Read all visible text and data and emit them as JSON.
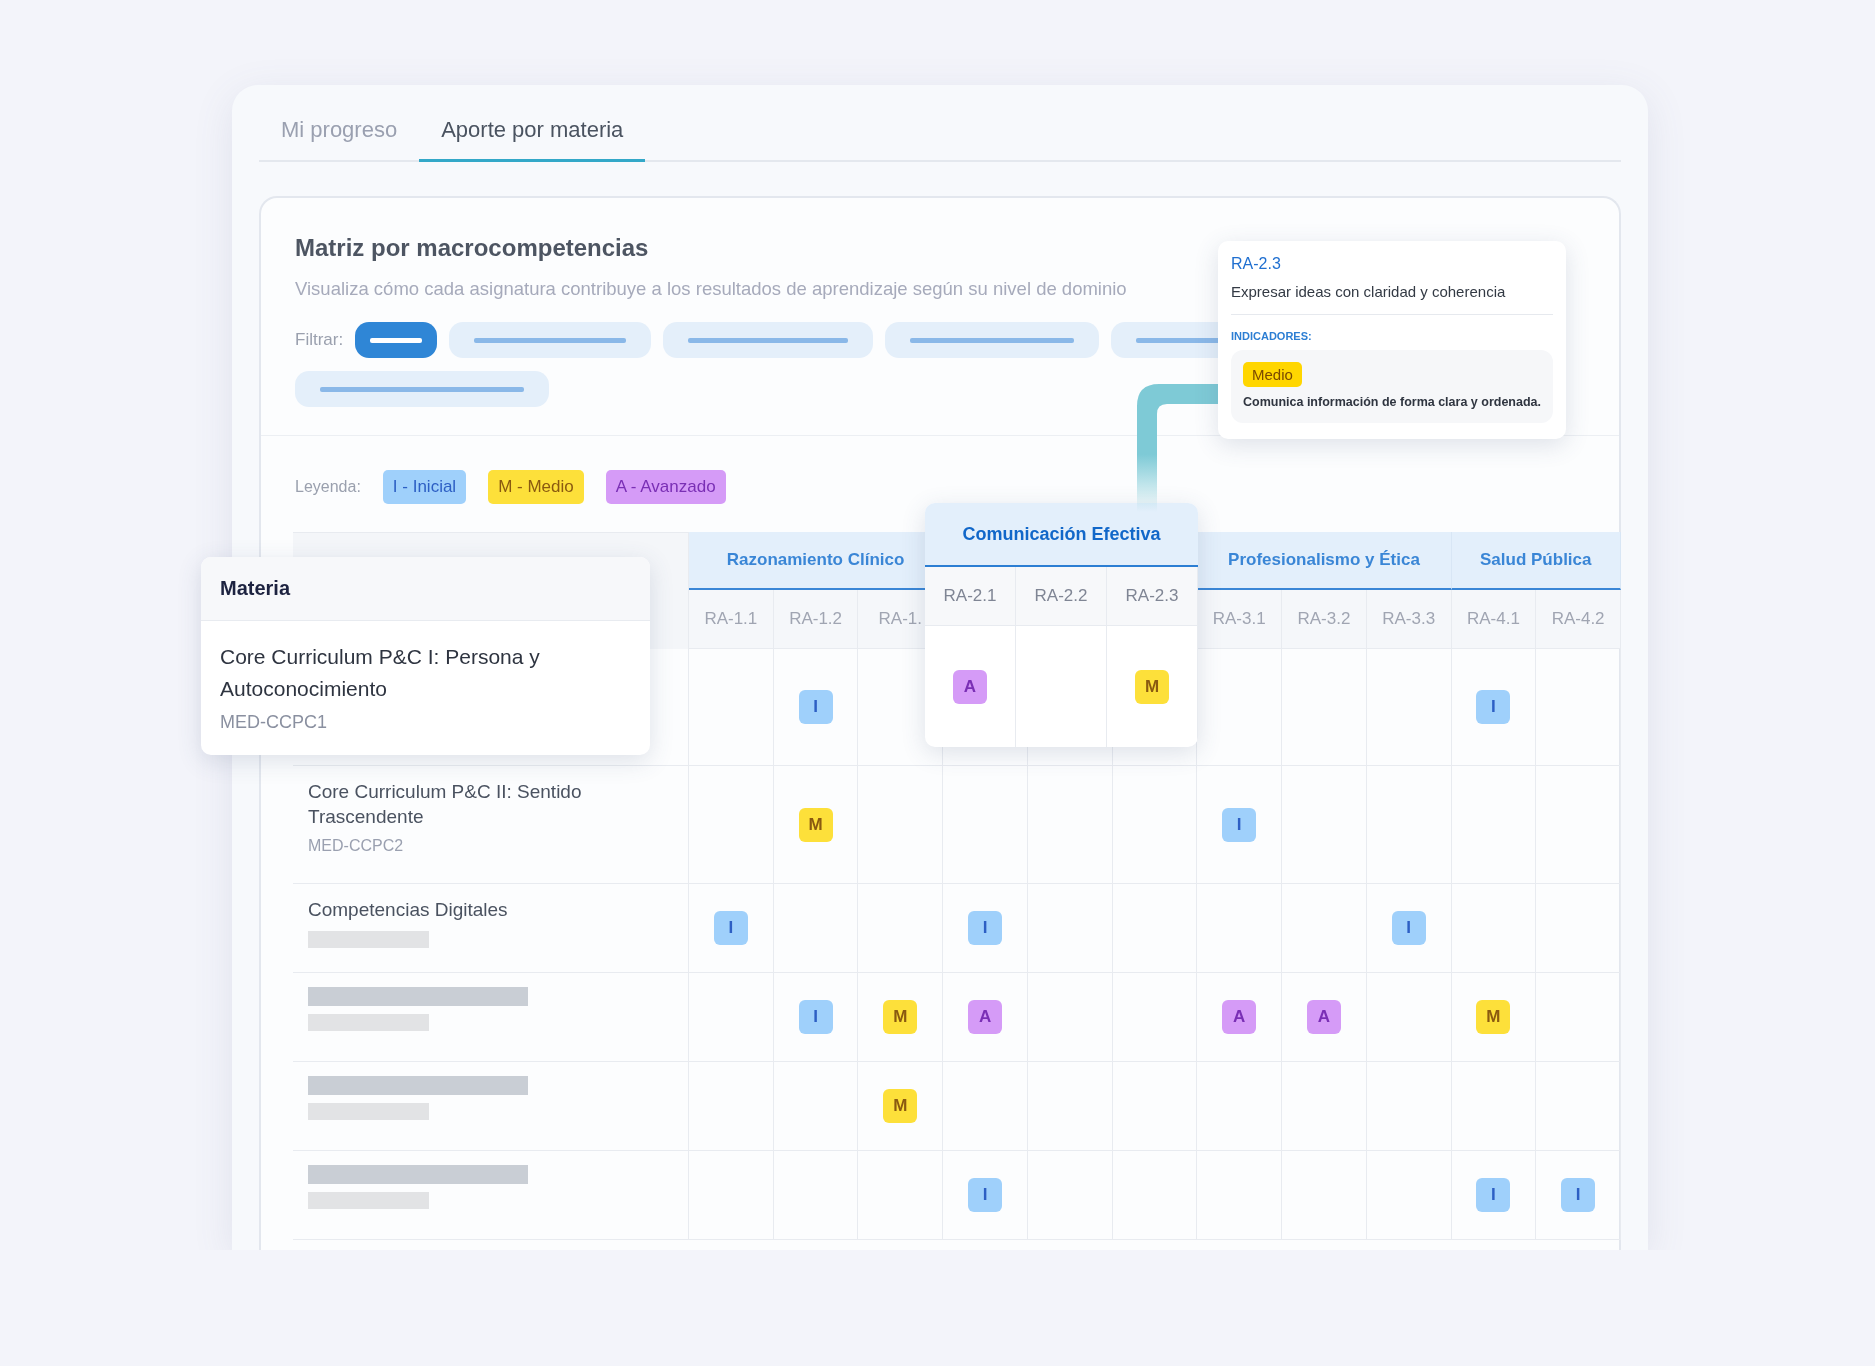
{
  "tabs": [
    {
      "label": "Mi progreso",
      "selected": false
    },
    {
      "label": "Aporte por materia",
      "selected": true
    }
  ],
  "panel": {
    "title": "Matriz por macrocompetencias",
    "subtitle": "Visualiza cómo cada asignatura contribuye a los resultados de aprendizaje según su nivel de dominio"
  },
  "filters": {
    "label": "Filtrar:",
    "chips": [
      {
        "selected": true
      },
      {
        "selected": false
      },
      {
        "selected": false
      },
      {
        "selected": false
      },
      {
        "selected": false
      },
      {
        "selected": false
      }
    ]
  },
  "legend": {
    "label": "Leyenda:",
    "items": [
      {
        "text": "I - Inicial",
        "kind": "inicial"
      },
      {
        "text": "M - Medio",
        "kind": "medio"
      },
      {
        "text": "A - Avanzado",
        "kind": "avanzado"
      }
    ]
  },
  "tooltip": {
    "code": "RA-2.3",
    "description": "Expresar ideas con claridad y coherencia",
    "section": "INDICADORES:",
    "badge": {
      "text": "Medio",
      "kind": "medio"
    },
    "indicator": "Comunica información de forma clara y ordenada."
  },
  "table": {
    "column_header": "Materia",
    "groups": [
      {
        "title": "Razonamiento Clínico",
        "raised": false,
        "columns": [
          "RA-1.1",
          "RA-1.2",
          "RA-1."
        ]
      },
      {
        "title": "Comunicación Efectiva",
        "raised": true,
        "columns": [
          "RA-2.1",
          "RA-2.2",
          "RA-2.3"
        ]
      },
      {
        "title": "Profesionalismo y Ética",
        "raised": false,
        "columns": [
          "RA-3.1",
          "RA-3.2",
          "RA-3.3"
        ]
      },
      {
        "title": "Salud Pública",
        "raised": false,
        "columns": [
          "RA-4.1",
          "RA-4.2"
        ]
      }
    ],
    "rows": [
      {
        "raised": true,
        "name": "Core Curriculum P&C I: Persona y Autoconocimiento",
        "code": "MED-CCPC1",
        "cells": [
          null,
          {
            "text": "I",
            "kind": "inicial"
          },
          null,
          {
            "text": "A",
            "kind": "avanzado"
          },
          null,
          {
            "text": "M",
            "kind": "medio"
          },
          null,
          null,
          null,
          {
            "text": "I",
            "kind": "inicial"
          },
          null
        ]
      },
      {
        "raised": false,
        "name": "Core Curriculum P&C II: Sentido Trascendente",
        "code": "MED-CCPC2",
        "cells": [
          null,
          {
            "text": "M",
            "kind": "medio"
          },
          null,
          null,
          null,
          null,
          {
            "text": "I",
            "kind": "inicial"
          },
          null,
          null,
          null,
          null
        ]
      },
      {
        "raised": false,
        "name": "Competencias Digitales",
        "cells": [
          {
            "text": "I",
            "kind": "inicial"
          },
          null,
          null,
          {
            "text": "I",
            "kind": "inicial"
          },
          null,
          null,
          null,
          null,
          {
            "text": "I",
            "kind": "inicial"
          },
          null,
          null
        ]
      },
      {
        "raised": false,
        "cells": [
          null,
          {
            "text": "I",
            "kind": "inicial"
          },
          {
            "text": "M",
            "kind": "medio"
          },
          {
            "text": "A",
            "kind": "avanzado"
          },
          null,
          null,
          {
            "text": "A",
            "kind": "avanzado"
          },
          {
            "text": "A",
            "kind": "avanzado"
          },
          null,
          {
            "text": "M",
            "kind": "medio"
          },
          null
        ]
      },
      {
        "raised": false,
        "cells": [
          null,
          null,
          {
            "text": "M",
            "kind": "medio"
          },
          null,
          null,
          null,
          null,
          null,
          null,
          null,
          null
        ]
      },
      {
        "raised": false,
        "cells": [
          null,
          null,
          null,
          {
            "text": "I",
            "kind": "inicial"
          },
          null,
          null,
          null,
          null,
          null,
          {
            "text": "I",
            "kind": "inicial"
          },
          {
            "text": "I",
            "kind": "inicial"
          }
        ]
      }
    ]
  }
}
